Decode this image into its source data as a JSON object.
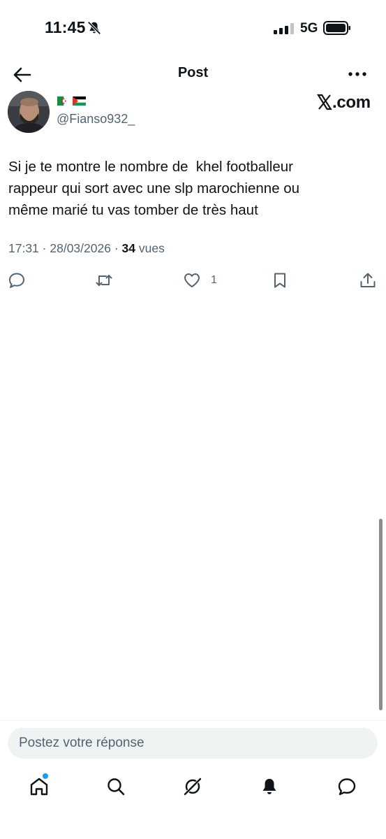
{
  "status_bar": {
    "time": "11:45",
    "network": "5G"
  },
  "header": {
    "title": "Post"
  },
  "author": {
    "flags": [
      "algeria-flag",
      "palestine-flag"
    ],
    "handle": "@Fianso932_"
  },
  "brand": {
    "text": ".com"
  },
  "tweet": {
    "lines": [
      "Si je te montre le nombre de  khel footballeur",
      "rappeur qui sort avec une slp marochienne ou",
      "même marié tu vas tomber de très haut"
    ],
    "time": "17:31",
    "date": "28/03/2026",
    "views_count": "34",
    "views_label": "vues",
    "separator": "·"
  },
  "actions": {
    "like_count": "1"
  },
  "reply_box": {
    "placeholder": "Postez votre réponse"
  },
  "colors": {
    "text_primary": "#0f1419",
    "text_secondary": "#536471",
    "accent": "#1d9bf0",
    "reply_bg": "#eff3f4"
  }
}
